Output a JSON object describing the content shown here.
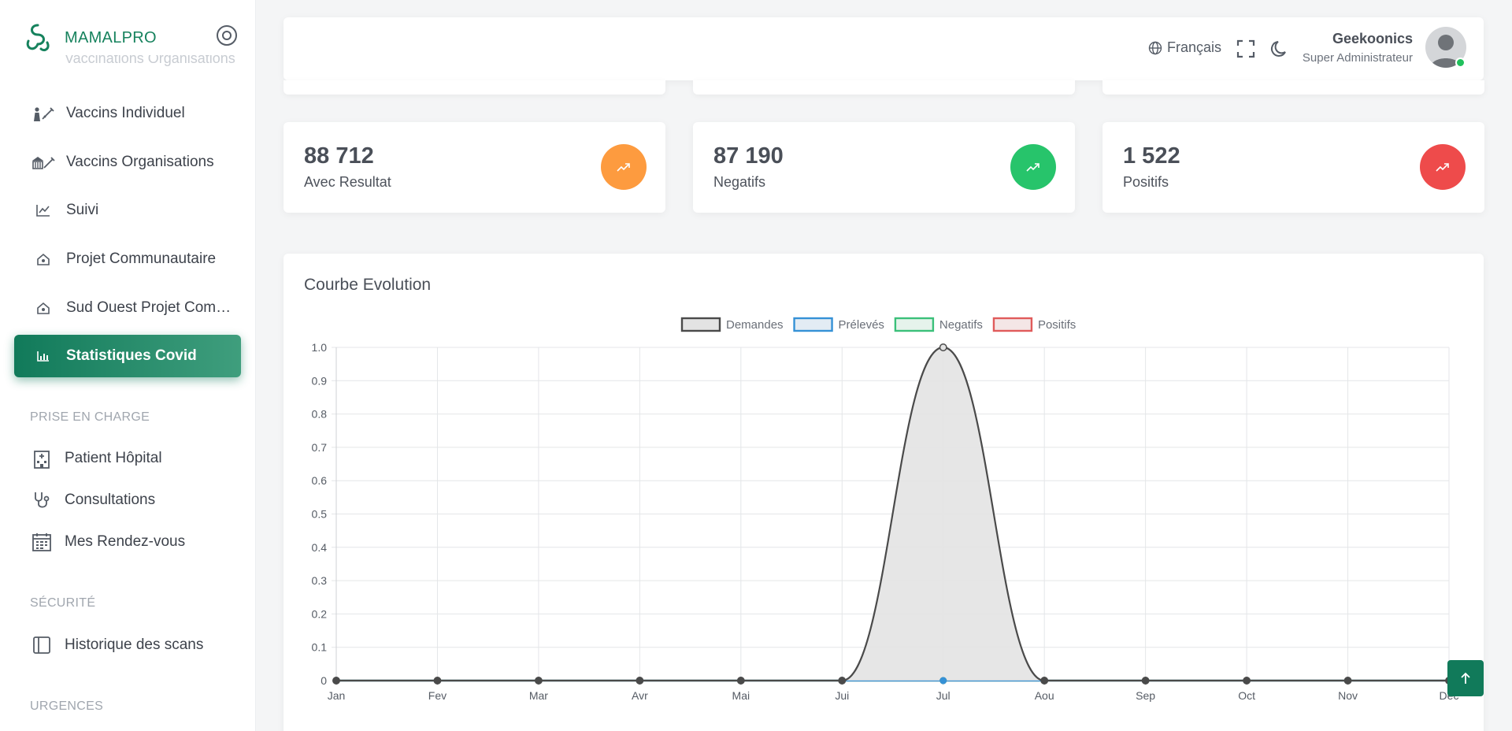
{
  "brand": {
    "name": "MAMALPRO"
  },
  "sidebar": {
    "ghost_label": "Vaccinations Organisations",
    "items": [
      {
        "label": "Vaccins Individuel",
        "icon": "person-syringe-icon"
      },
      {
        "label": "Vaccins Organisations",
        "icon": "building-syringe-icon"
      },
      {
        "label": "Suivi",
        "icon": "line-chart-icon"
      },
      {
        "label": "Projet Communautaire",
        "icon": "community-home-icon"
      },
      {
        "label": "Sud Ouest Projet Communautaire",
        "icon": "community-home-icon"
      },
      {
        "label": "Statistiques Covid",
        "icon": "bar-chart-icon",
        "active": true
      }
    ],
    "sections": [
      {
        "title": "PRISE EN CHARGE",
        "items": [
          {
            "label": "Patient Hôpital",
            "icon": "hospital-icon"
          },
          {
            "label": "Consultations",
            "icon": "stethoscope-icon"
          },
          {
            "label": "Mes Rendez-vous",
            "icon": "calendar-icon"
          }
        ]
      },
      {
        "title": "SÉCURITÉ",
        "items": [
          {
            "label": "Historique des scans",
            "icon": "sidebar-panel-icon"
          }
        ]
      },
      {
        "title": "URGENCES",
        "items": []
      }
    ]
  },
  "header": {
    "language": "Français",
    "user_name": "Geekoonics",
    "user_role": "Super Administrateur",
    "status": "online"
  },
  "stats": [
    {
      "value": "88 712",
      "label": "Avec Resultat",
      "color": "#fd9b3f",
      "icon": "trending-up-icon"
    },
    {
      "value": "87 190",
      "label": "Negatifs",
      "color": "#27c46b",
      "icon": "trending-up-icon"
    },
    {
      "value": "1 522",
      "label": "Positifs",
      "color": "#ee4b4b",
      "icon": "trending-up-icon"
    }
  ],
  "chart_title": "Courbe Evolution",
  "chart_data": {
    "type": "line",
    "categories": [
      "Jan",
      "Fev",
      "Mar",
      "Avr",
      "Mai",
      "Jui",
      "Jul",
      "Aou",
      "Sep",
      "Oct",
      "Nov",
      "Dec"
    ],
    "ylim": [
      0,
      1.0
    ],
    "yticks": [
      "0",
      "0.1",
      "0.2",
      "0.3",
      "0.4",
      "0.5",
      "0.6",
      "0.7",
      "0.8",
      "0.9",
      "1.0"
    ],
    "grid": true,
    "legend_position": "top",
    "series": [
      {
        "name": "Demandes",
        "color": "#4a4a4a",
        "fill": "#e3e3e3",
        "values": [
          0,
          0,
          0,
          0,
          0,
          0,
          1,
          0,
          0,
          0,
          0,
          0
        ]
      },
      {
        "name": "Prélevés",
        "color": "#3591d6",
        "fill": "#e3ecf4",
        "values": [
          0,
          0,
          0,
          0,
          0,
          0,
          0,
          0,
          0,
          0,
          0,
          0
        ]
      },
      {
        "name": "Negatifs",
        "color": "#3bc07a",
        "fill": "#e6f3ec",
        "values": [
          0,
          0,
          0,
          0,
          0,
          0,
          0,
          0,
          0,
          0,
          0,
          0
        ]
      },
      {
        "name": "Positifs",
        "color": "#e05b5b",
        "fill": "#f4e6e6",
        "values": [
          0,
          0,
          0,
          0,
          0,
          0,
          0,
          0,
          0,
          0,
          0,
          0
        ]
      }
    ]
  }
}
